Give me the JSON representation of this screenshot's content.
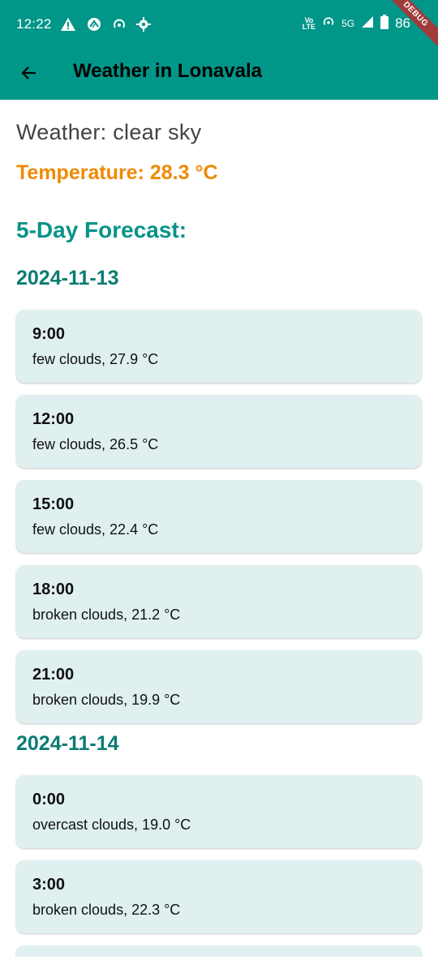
{
  "status_bar": {
    "time": "12:22",
    "left_icons": [
      "alert-icon",
      "app-icon",
      "hotspot-icon",
      "gear-icon"
    ],
    "right_icons": [
      "vo-lte-icon",
      "hotspot-icon",
      "signal-icon",
      "battery-icon"
    ],
    "volte_label_top": "Vo",
    "volte_label_bottom": "LTE",
    "network": "5G",
    "battery": "86",
    "debug_label": "DEBUG"
  },
  "app_bar": {
    "title": "Weather in Lonavala",
    "back_icon": "arrow-left-icon"
  },
  "current_weather": {
    "description": "Weather: clear sky",
    "temperature": "Temperature: 28.3 °C"
  },
  "forecast": {
    "heading": "5-Day Forecast:",
    "days": [
      {
        "date": "2024-11-13",
        "items": [
          {
            "time": "9:00",
            "desc": "few clouds, 27.9 °C"
          },
          {
            "time": "12:00",
            "desc": "few clouds, 26.5 °C"
          },
          {
            "time": "15:00",
            "desc": "few clouds, 22.4 °C"
          },
          {
            "time": "18:00",
            "desc": "broken clouds, 21.2 °C"
          },
          {
            "time": "21:00",
            "desc": "broken clouds, 19.9 °C"
          }
        ]
      },
      {
        "date": "2024-11-14",
        "items": [
          {
            "time": "0:00",
            "desc": "overcast clouds, 19.0 °C"
          },
          {
            "time": "3:00",
            "desc": "broken clouds, 22.3 °C"
          },
          {
            "time": "",
            "desc": ""
          }
        ]
      }
    ]
  },
  "colors": {
    "primary": "#009688",
    "temperature": "#f08a00",
    "heading": "#079488",
    "card": "#e0f0f0"
  }
}
